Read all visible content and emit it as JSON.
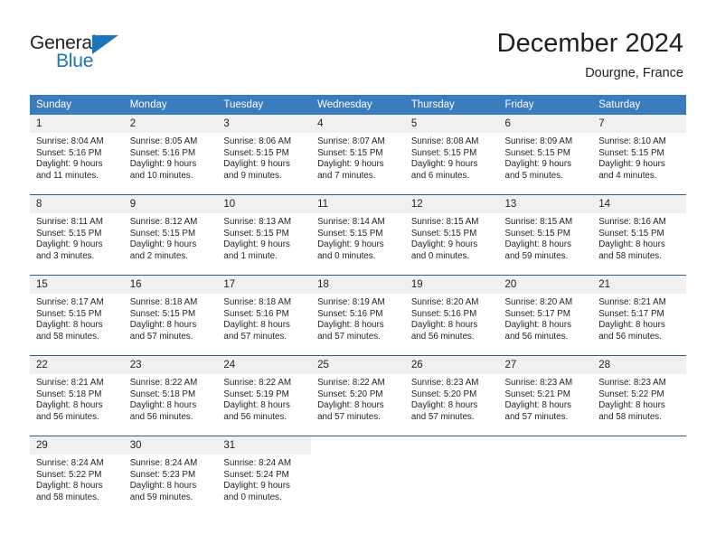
{
  "logo": {
    "word_top": "General",
    "word_bottom": "Blue",
    "triangle_color": "#1b75bb",
    "text_color": "#231f20"
  },
  "header": {
    "title": "December 2024",
    "subtitle": "Dourgne, France"
  },
  "theme": {
    "header_row_bg": "#3a7dbf",
    "week_separator": "#2a5f92",
    "daynum_bg": "#f0f0f0"
  },
  "calendar": {
    "weekday_headers": [
      "Sunday",
      "Monday",
      "Tuesday",
      "Wednesday",
      "Thursday",
      "Friday",
      "Saturday"
    ],
    "weeks": [
      [
        {
          "day": "1",
          "sunrise": "Sunrise: 8:04 AM",
          "sunset": "Sunset: 5:16 PM",
          "daylight_line1": "Daylight: 9 hours",
          "daylight_line2": "and 11 minutes."
        },
        {
          "day": "2",
          "sunrise": "Sunrise: 8:05 AM",
          "sunset": "Sunset: 5:16 PM",
          "daylight_line1": "Daylight: 9 hours",
          "daylight_line2": "and 10 minutes."
        },
        {
          "day": "3",
          "sunrise": "Sunrise: 8:06 AM",
          "sunset": "Sunset: 5:15 PM",
          "daylight_line1": "Daylight: 9 hours",
          "daylight_line2": "and 9 minutes."
        },
        {
          "day": "4",
          "sunrise": "Sunrise: 8:07 AM",
          "sunset": "Sunset: 5:15 PM",
          "daylight_line1": "Daylight: 9 hours",
          "daylight_line2": "and 7 minutes."
        },
        {
          "day": "5",
          "sunrise": "Sunrise: 8:08 AM",
          "sunset": "Sunset: 5:15 PM",
          "daylight_line1": "Daylight: 9 hours",
          "daylight_line2": "and 6 minutes."
        },
        {
          "day": "6",
          "sunrise": "Sunrise: 8:09 AM",
          "sunset": "Sunset: 5:15 PM",
          "daylight_line1": "Daylight: 9 hours",
          "daylight_line2": "and 5 minutes."
        },
        {
          "day": "7",
          "sunrise": "Sunrise: 8:10 AM",
          "sunset": "Sunset: 5:15 PM",
          "daylight_line1": "Daylight: 9 hours",
          "daylight_line2": "and 4 minutes."
        }
      ],
      [
        {
          "day": "8",
          "sunrise": "Sunrise: 8:11 AM",
          "sunset": "Sunset: 5:15 PM",
          "daylight_line1": "Daylight: 9 hours",
          "daylight_line2": "and 3 minutes."
        },
        {
          "day": "9",
          "sunrise": "Sunrise: 8:12 AM",
          "sunset": "Sunset: 5:15 PM",
          "daylight_line1": "Daylight: 9 hours",
          "daylight_line2": "and 2 minutes."
        },
        {
          "day": "10",
          "sunrise": "Sunrise: 8:13 AM",
          "sunset": "Sunset: 5:15 PM",
          "daylight_line1": "Daylight: 9 hours",
          "daylight_line2": "and 1 minute."
        },
        {
          "day": "11",
          "sunrise": "Sunrise: 8:14 AM",
          "sunset": "Sunset: 5:15 PM",
          "daylight_line1": "Daylight: 9 hours",
          "daylight_line2": "and 0 minutes."
        },
        {
          "day": "12",
          "sunrise": "Sunrise: 8:15 AM",
          "sunset": "Sunset: 5:15 PM",
          "daylight_line1": "Daylight: 9 hours",
          "daylight_line2": "and 0 minutes."
        },
        {
          "day": "13",
          "sunrise": "Sunrise: 8:15 AM",
          "sunset": "Sunset: 5:15 PM",
          "daylight_line1": "Daylight: 8 hours",
          "daylight_line2": "and 59 minutes."
        },
        {
          "day": "14",
          "sunrise": "Sunrise: 8:16 AM",
          "sunset": "Sunset: 5:15 PM",
          "daylight_line1": "Daylight: 8 hours",
          "daylight_line2": "and 58 minutes."
        }
      ],
      [
        {
          "day": "15",
          "sunrise": "Sunrise: 8:17 AM",
          "sunset": "Sunset: 5:15 PM",
          "daylight_line1": "Daylight: 8 hours",
          "daylight_line2": "and 58 minutes."
        },
        {
          "day": "16",
          "sunrise": "Sunrise: 8:18 AM",
          "sunset": "Sunset: 5:15 PM",
          "daylight_line1": "Daylight: 8 hours",
          "daylight_line2": "and 57 minutes."
        },
        {
          "day": "17",
          "sunrise": "Sunrise: 8:18 AM",
          "sunset": "Sunset: 5:16 PM",
          "daylight_line1": "Daylight: 8 hours",
          "daylight_line2": "and 57 minutes."
        },
        {
          "day": "18",
          "sunrise": "Sunrise: 8:19 AM",
          "sunset": "Sunset: 5:16 PM",
          "daylight_line1": "Daylight: 8 hours",
          "daylight_line2": "and 57 minutes."
        },
        {
          "day": "19",
          "sunrise": "Sunrise: 8:20 AM",
          "sunset": "Sunset: 5:16 PM",
          "daylight_line1": "Daylight: 8 hours",
          "daylight_line2": "and 56 minutes."
        },
        {
          "day": "20",
          "sunrise": "Sunrise: 8:20 AM",
          "sunset": "Sunset: 5:17 PM",
          "daylight_line1": "Daylight: 8 hours",
          "daylight_line2": "and 56 minutes."
        },
        {
          "day": "21",
          "sunrise": "Sunrise: 8:21 AM",
          "sunset": "Sunset: 5:17 PM",
          "daylight_line1": "Daylight: 8 hours",
          "daylight_line2": "and 56 minutes."
        }
      ],
      [
        {
          "day": "22",
          "sunrise": "Sunrise: 8:21 AM",
          "sunset": "Sunset: 5:18 PM",
          "daylight_line1": "Daylight: 8 hours",
          "daylight_line2": "and 56 minutes."
        },
        {
          "day": "23",
          "sunrise": "Sunrise: 8:22 AM",
          "sunset": "Sunset: 5:18 PM",
          "daylight_line1": "Daylight: 8 hours",
          "daylight_line2": "and 56 minutes."
        },
        {
          "day": "24",
          "sunrise": "Sunrise: 8:22 AM",
          "sunset": "Sunset: 5:19 PM",
          "daylight_line1": "Daylight: 8 hours",
          "daylight_line2": "and 56 minutes."
        },
        {
          "day": "25",
          "sunrise": "Sunrise: 8:22 AM",
          "sunset": "Sunset: 5:20 PM",
          "daylight_line1": "Daylight: 8 hours",
          "daylight_line2": "and 57 minutes."
        },
        {
          "day": "26",
          "sunrise": "Sunrise: 8:23 AM",
          "sunset": "Sunset: 5:20 PM",
          "daylight_line1": "Daylight: 8 hours",
          "daylight_line2": "and 57 minutes."
        },
        {
          "day": "27",
          "sunrise": "Sunrise: 8:23 AM",
          "sunset": "Sunset: 5:21 PM",
          "daylight_line1": "Daylight: 8 hours",
          "daylight_line2": "and 57 minutes."
        },
        {
          "day": "28",
          "sunrise": "Sunrise: 8:23 AM",
          "sunset": "Sunset: 5:22 PM",
          "daylight_line1": "Daylight: 8 hours",
          "daylight_line2": "and 58 minutes."
        }
      ],
      [
        {
          "day": "29",
          "sunrise": "Sunrise: 8:24 AM",
          "sunset": "Sunset: 5:22 PM",
          "daylight_line1": "Daylight: 8 hours",
          "daylight_line2": "and 58 minutes."
        },
        {
          "day": "30",
          "sunrise": "Sunrise: 8:24 AM",
          "sunset": "Sunset: 5:23 PM",
          "daylight_line1": "Daylight: 8 hours",
          "daylight_line2": "and 59 minutes."
        },
        {
          "day": "31",
          "sunrise": "Sunrise: 8:24 AM",
          "sunset": "Sunset: 5:24 PM",
          "daylight_line1": "Daylight: 9 hours",
          "daylight_line2": "and 0 minutes."
        },
        {
          "day": "",
          "sunrise": "",
          "sunset": "",
          "daylight_line1": "",
          "daylight_line2": ""
        },
        {
          "day": "",
          "sunrise": "",
          "sunset": "",
          "daylight_line1": "",
          "daylight_line2": ""
        },
        {
          "day": "",
          "sunrise": "",
          "sunset": "",
          "daylight_line1": "",
          "daylight_line2": ""
        },
        {
          "day": "",
          "sunrise": "",
          "sunset": "",
          "daylight_line1": "",
          "daylight_line2": ""
        }
      ]
    ]
  }
}
